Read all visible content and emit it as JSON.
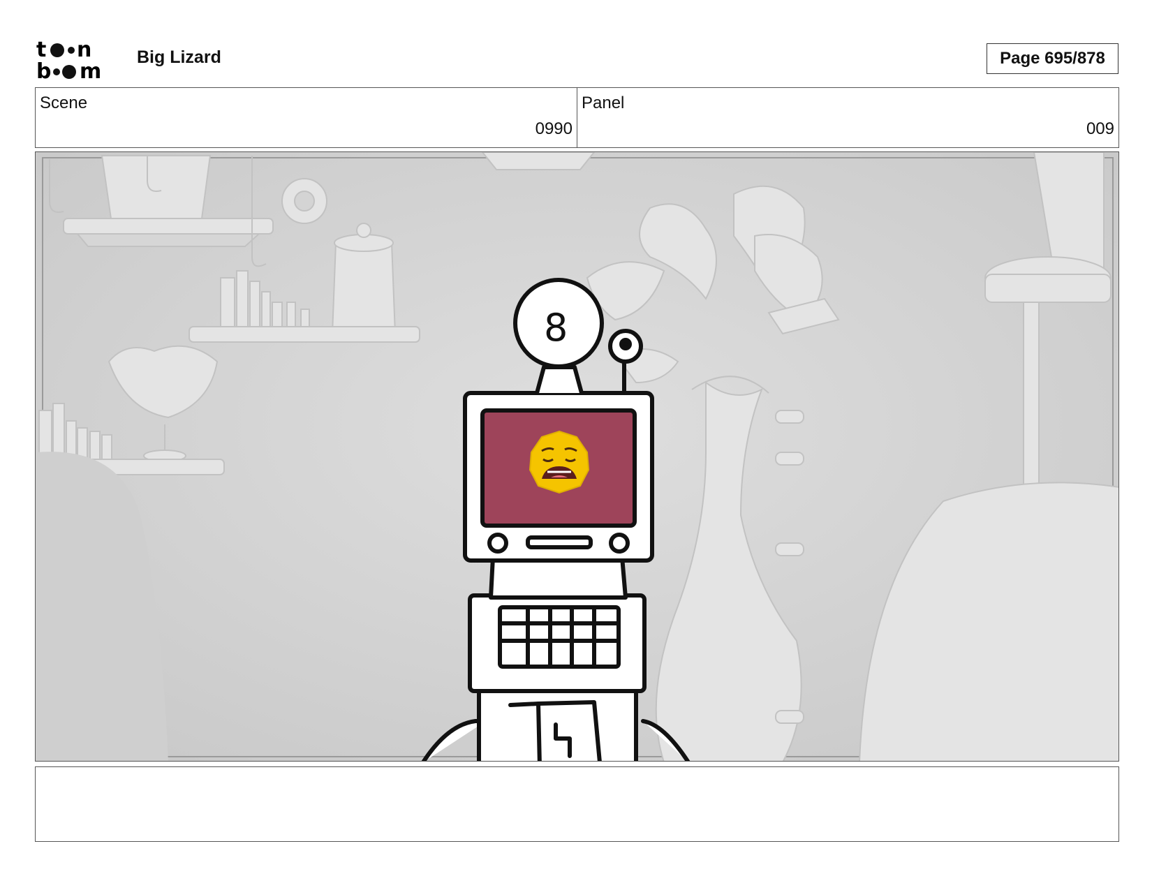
{
  "header": {
    "logo_text_top": "toon",
    "logo_text_bottom": "boom",
    "project_title": "Big Lizard",
    "page_label": "Page 695/878"
  },
  "scene": {
    "label": "Scene",
    "value": "0990"
  },
  "panel": {
    "label": "Panel",
    "value": "009"
  },
  "notes": {
    "text": ""
  }
}
